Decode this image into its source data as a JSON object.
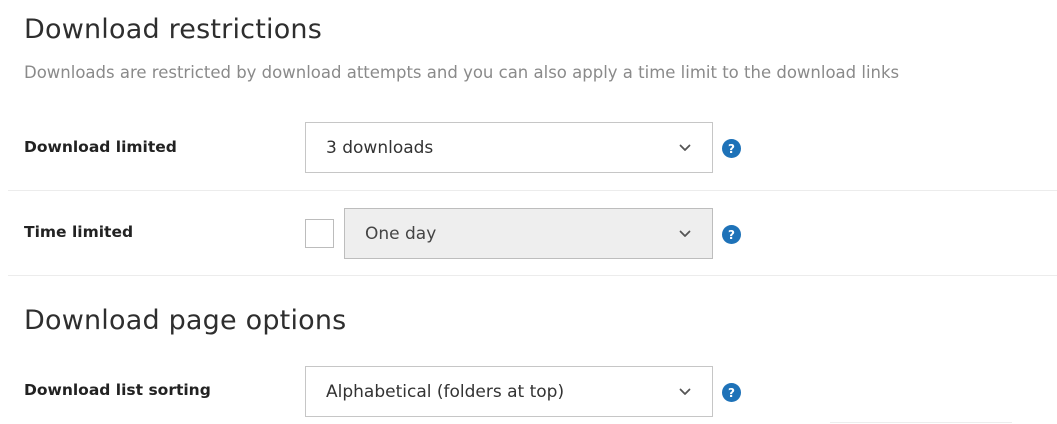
{
  "restrictions": {
    "title": "Download restrictions",
    "description": "Downloads are restricted by download attempts and you can also apply a time limit to the download links",
    "download_limited": {
      "label": "Download limited",
      "selected": "3 downloads",
      "help_icon": "question-circle-icon",
      "help_glyph": "?"
    },
    "time_limited": {
      "label": "Time limited",
      "checked": false,
      "selected": "One day",
      "disabled": true,
      "help_icon": "question-circle-icon",
      "help_glyph": "?"
    }
  },
  "page_options": {
    "title": "Download page options",
    "list_sorting": {
      "label": "Download list sorting",
      "selected": "Alphabetical (folders at top)",
      "help_icon": "question-circle-icon",
      "help_glyph": "?"
    }
  },
  "colors": {
    "help_icon_bg": "#1e72b8",
    "disabled_select_bg": "#eeeeee",
    "description_text": "#8a8a8a"
  }
}
